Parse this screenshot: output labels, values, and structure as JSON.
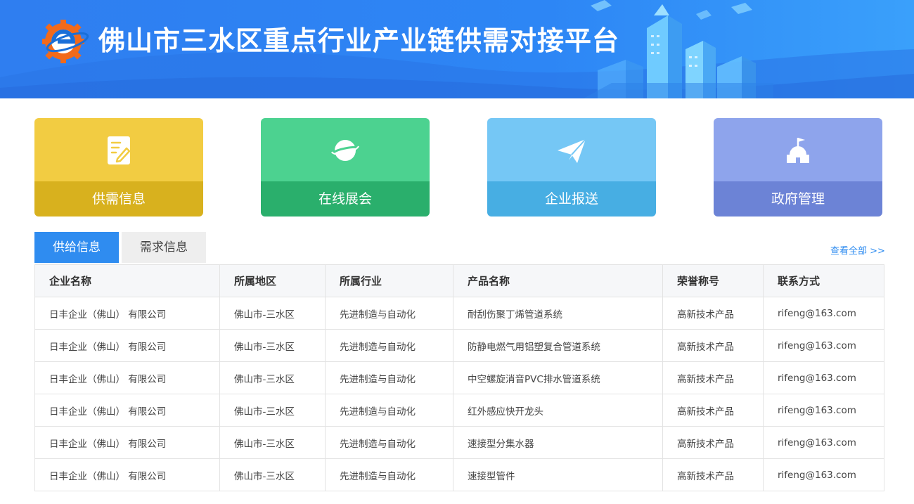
{
  "header": {
    "title": "佛山市三水区重点行业产业链供需对接平台"
  },
  "cards": [
    {
      "label": "供需信息",
      "icon": "document-edit-icon"
    },
    {
      "label": "在线展会",
      "icon": "planet-icon"
    },
    {
      "label": "企业报送",
      "icon": "paper-plane-icon"
    },
    {
      "label": "政府管理",
      "icon": "government-building-icon"
    }
  ],
  "tabs": {
    "supply": "供给信息",
    "demand": "需求信息",
    "view_all": "查看全部 >>"
  },
  "table": {
    "columns": [
      "企业名称",
      "所属地区",
      "所属行业",
      "产品名称",
      "荣誉称号",
      "联系方式"
    ],
    "rows": [
      [
        "日丰企业（佛山） 有限公司",
        "佛山市-三水区",
        "先进制造与自动化",
        "耐刮伤聚丁烯管道系统",
        "高新技术产品",
        "rifeng@163.com"
      ],
      [
        "日丰企业（佛山） 有限公司",
        "佛山市-三水区",
        "先进制造与自动化",
        "防静电燃气用铝塑复合管道系统",
        "高新技术产品",
        "rifeng@163.com"
      ],
      [
        "日丰企业（佛山） 有限公司",
        "佛山市-三水区",
        "先进制造与自动化",
        "中空螺旋消音PVC排水管道系统",
        "高新技术产品",
        "rifeng@163.com"
      ],
      [
        "日丰企业（佛山） 有限公司",
        "佛山市-三水区",
        "先进制造与自动化",
        "红外感应快开龙头",
        "高新技术产品",
        "rifeng@163.com"
      ],
      [
        "日丰企业（佛山） 有限公司",
        "佛山市-三水区",
        "先进制造与自动化",
        "速接型分集水器",
        "高新技术产品",
        "rifeng@163.com"
      ],
      [
        "日丰企业（佛山） 有限公司",
        "佛山市-三水区",
        "先进制造与自动化",
        "速接型管件",
        "高新技术产品",
        "rifeng@163.com"
      ]
    ]
  },
  "colors": {
    "header": "#2f7ef0",
    "card_supply": "#f2cc42",
    "card_expo": "#4cd290",
    "card_report": "#75c7f5",
    "card_gov": "#8ea4ec",
    "tab_active": "#2f8cf0",
    "link": "#2f8cf0"
  }
}
